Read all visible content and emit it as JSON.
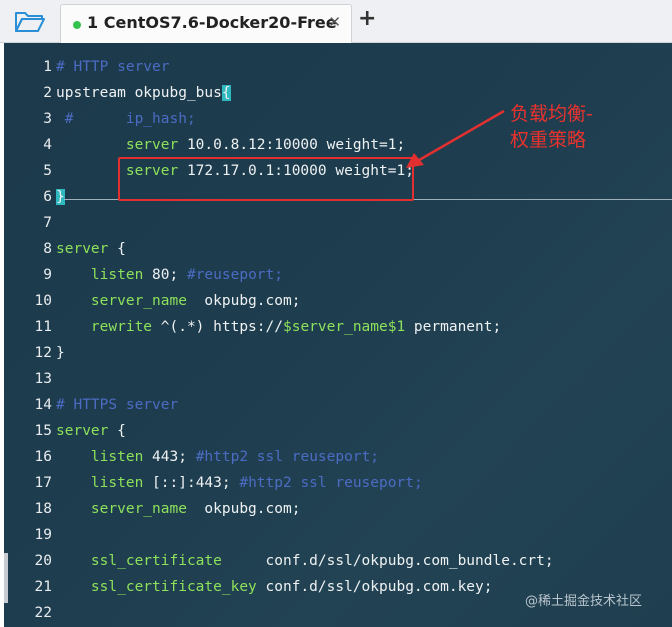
{
  "tab": {
    "index": "1",
    "title": "CentOS7.6-Docker20-Free",
    "close_glyph": "✕",
    "add_glyph": "+",
    "status_color": "#33c24d"
  },
  "editor": {
    "lines": [
      {
        "n": "1",
        "parts": [
          [
            "comment",
            "# HTTP server"
          ]
        ]
      },
      {
        "n": "2",
        "parts": [
          [
            "white",
            "upstream okpubg_bus"
          ],
          [
            "cursor",
            "{"
          ]
        ]
      },
      {
        "n": "3",
        "parts": [
          [
            "comment",
            " #      ip_hash;"
          ]
        ]
      },
      {
        "n": "4",
        "parts": [
          [
            "green",
            "        server"
          ],
          [
            "white",
            " 10.0.8.12:10000 weight=1;"
          ]
        ]
      },
      {
        "n": "5",
        "parts": [
          [
            "green",
            "        server"
          ],
          [
            "white",
            " 172.17.0.1:10000 weight=1;"
          ]
        ]
      },
      {
        "n": "6",
        "parts": [
          [
            "cursor",
            "}"
          ]
        ]
      },
      {
        "n": "7",
        "parts": []
      },
      {
        "n": "8",
        "parts": [
          [
            "green",
            "server"
          ],
          [
            "white",
            " {"
          ]
        ]
      },
      {
        "n": "9",
        "parts": [
          [
            "green",
            "    listen"
          ],
          [
            "white",
            " 80; "
          ],
          [
            "comment",
            "#reuseport;"
          ]
        ]
      },
      {
        "n": "10",
        "parts": [
          [
            "green",
            "    server_name"
          ],
          [
            "white",
            "  okpubg.com;"
          ]
        ]
      },
      {
        "n": "11",
        "parts": [
          [
            "green",
            "    rewrite"
          ],
          [
            "white",
            " ^(.*) https://"
          ],
          [
            "green",
            "$server_name$1"
          ],
          [
            "white",
            " permanent;"
          ]
        ]
      },
      {
        "n": "12",
        "parts": [
          [
            "white",
            "}"
          ]
        ]
      },
      {
        "n": "13",
        "parts": []
      },
      {
        "n": "14",
        "parts": [
          [
            "comment",
            "# HTTPS server"
          ]
        ]
      },
      {
        "n": "15",
        "parts": [
          [
            "green",
            "server"
          ],
          [
            "white",
            " {"
          ]
        ]
      },
      {
        "n": "16",
        "parts": [
          [
            "green",
            "    listen"
          ],
          [
            "white",
            " 443; "
          ],
          [
            "comment",
            "#http2 ssl reuseport;"
          ]
        ]
      },
      {
        "n": "17",
        "parts": [
          [
            "green",
            "    listen"
          ],
          [
            "white",
            " [::]:443; "
          ],
          [
            "comment",
            "#http2 ssl reuseport;"
          ]
        ]
      },
      {
        "n": "18",
        "parts": [
          [
            "green",
            "    server_name"
          ],
          [
            "white",
            "  okpubg.com;"
          ]
        ]
      },
      {
        "n": "19",
        "parts": []
      },
      {
        "n": "20",
        "parts": [
          [
            "green",
            "    ssl_certificate"
          ],
          [
            "white",
            "     conf.d/ssl/okpubg.com_bundle.crt;"
          ]
        ]
      },
      {
        "n": "21",
        "parts": [
          [
            "green",
            "    ssl_certificate_key"
          ],
          [
            "white",
            " conf.d/ssl/okpubg.com.key;"
          ]
        ]
      },
      {
        "n": "22",
        "parts": []
      }
    ]
  },
  "annotation": {
    "line1": "负载均衡-",
    "line2": "权重策略",
    "color": "#e23030"
  },
  "watermark": "@稀土掘金技术社区",
  "icons": {
    "folder": "folder-open-icon"
  }
}
